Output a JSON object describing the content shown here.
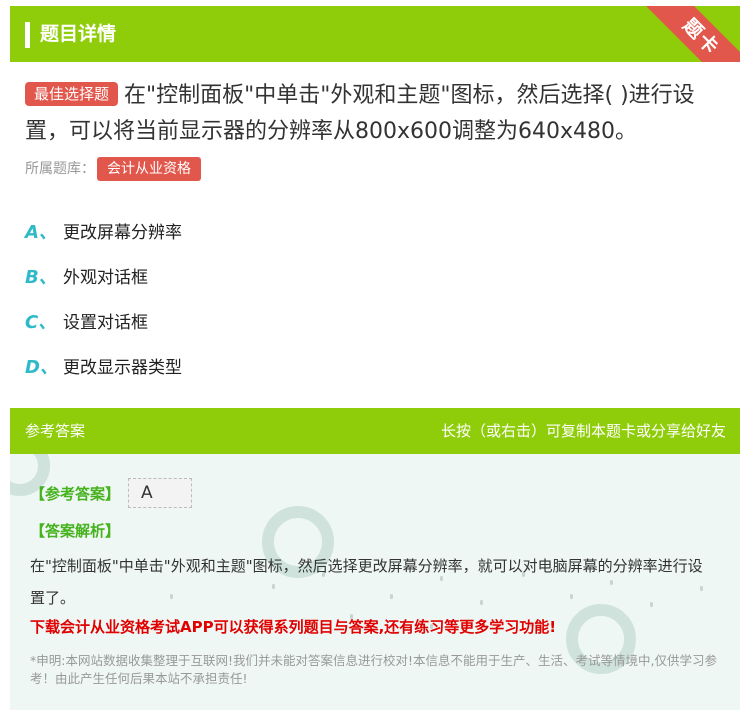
{
  "header": {
    "title": "题目详情",
    "ribbon": "题卡"
  },
  "question": {
    "type_tag": "最佳选择题",
    "text": "在\"控制面板\"中单击\"外观和主题\"图标，然后选择( )进行设置，可以将当前显示器的分辨率从800x600调整为640x480。",
    "library_label": "所属题库：",
    "library_tag": "会计从业资格"
  },
  "options": [
    {
      "letter": "A、",
      "text": "更改屏幕分辨率"
    },
    {
      "letter": "B、",
      "text": "外观对话框"
    },
    {
      "letter": "C、",
      "text": "设置对话框"
    },
    {
      "letter": "D、",
      "text": "更改显示器类型"
    }
  ],
  "answer": {
    "section_title": "参考答案",
    "share_hint": "长按（或右击）可复制本题卡或分享给好友",
    "answer_label": "【参考答案】",
    "answer_value": "A",
    "analysis_label": "【答案解析】",
    "analysis_text": "在\"控制面板\"中单击\"外观和主题\"图标，然后选择更改屏幕分辨率，就可以对电脑屏幕的分辨率进行设置了。",
    "promo": "下载会计从业资格考试APP可以获得系列题目与答案,还有练习等更多学习功能!",
    "disclaimer": "*申明:本网站数据收集整理于互联网!我们并未能对答案信息进行校对!本信息不能用于生产、生活、考试等情境中,仅供学习参考！由此产生任何后果本站不承担责任!"
  },
  "colors": {
    "brand_green": "#8fcd0b",
    "tag_red": "#e2574c",
    "option_teal": "#2fbac9",
    "answer_green": "#46b21e",
    "promo_red": "#e00000"
  }
}
